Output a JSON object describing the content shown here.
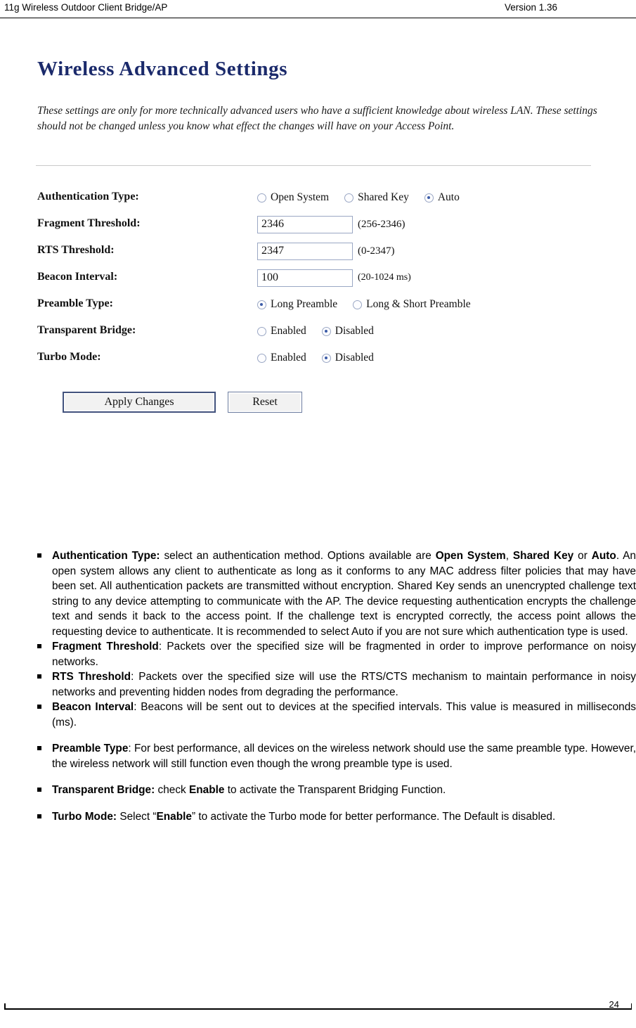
{
  "header": {
    "left_title": "11g Wireless Outdoor Client Bridge/AP",
    "right_version": "Version 1.36"
  },
  "screenshot": {
    "title": "Wireless Advanced Settings",
    "description": "These settings are only for more technically advanced users who have a sufficient knowledge about wireless LAN. These settings should not be changed unless you know what effect the changes will have on your Access Point.",
    "fields": {
      "auth_type": {
        "label": "Authentication Type:",
        "options": [
          "Open System",
          "Shared Key",
          "Auto"
        ],
        "selected": "Auto"
      },
      "fragment_threshold": {
        "label": "Fragment Threshold:",
        "value": "2346",
        "hint": "(256-2346)"
      },
      "rts_threshold": {
        "label": "RTS Threshold:",
        "value": "2347",
        "hint": "(0-2347)"
      },
      "beacon_interval": {
        "label": "Beacon Interval:",
        "value": "100",
        "hint": "(20-1024 ms)"
      },
      "preamble_type": {
        "label": "Preamble Type:",
        "options": [
          "Long Preamble",
          "Long & Short Preamble"
        ],
        "selected": "Long Preamble"
      },
      "transparent_bridge": {
        "label": "Transparent Bridge:",
        "options": [
          "Enabled",
          "Disabled"
        ],
        "selected": "Disabled"
      },
      "turbo_mode": {
        "label": "Turbo Mode:",
        "options": [
          "Enabled",
          "Disabled"
        ],
        "selected": "Disabled"
      }
    },
    "buttons": {
      "apply": "Apply Changes",
      "reset": "Reset"
    }
  },
  "bullets": [
    {
      "term": "Authentication Type:",
      "html": "<b>Authentication Type:</b> select an authentication method. Options available are <b>Open System</b>, <b>Shared Key</b> or <b>Auto</b>. An open system allows any client to authenticate as long as it conforms to any MAC address filter policies that may have been set. All authentication packets are transmitted without encryption. Shared Key sends an unencrypted challenge text string to any device attempting to communicate with the AP. The device requesting authentication encrypts the challenge text and sends it back to the access point. If the challenge text is encrypted correctly, the access point allows the requesting device to authenticate. It is recommended to select Auto if you are not sure which authentication type is used.",
      "gap_after": false
    },
    {
      "term": "Fragment Threshold",
      "html": "<b>Fragment Threshold</b>: Packets over the specified size will be fragmented in order to improve performance on noisy networks.",
      "gap_after": false
    },
    {
      "term": "RTS Threshold",
      "html": "<b>RTS Threshold</b>: Packets over the specified size will use the RTS/CTS mechanism to maintain performance in noisy networks and preventing hidden nodes from degrading the performance.",
      "gap_after": false
    },
    {
      "term": "Beacon Interval",
      "html": "<b>Beacon Interval</b>: Beacons will be sent out to devices at the specified intervals. This value is measured in milliseconds (ms).",
      "gap_after": true
    },
    {
      "term": "Preamble Type:",
      "html": "<b>Preamble Type</b>: For best performance, all devices on the wireless network should use the same preamble type. However, the wireless network will still function even though the wrong preamble type is used.",
      "gap_after": true
    },
    {
      "term": "Transparent Bridge:",
      "html": "<b>Transparent Bridge:</b> check <b>Enable</b> to activate the Transparent Bridging Function.",
      "gap_after": true
    },
    {
      "term": "Turbo Mode:",
      "html": "<b>Turbo Mode:</b> Select &ldquo;<b>Enable</b>&rdquo; to activate the Turbo mode for better performance. The Default is disabled.",
      "gap_after": false
    }
  ],
  "footer": {
    "page_number": "24"
  }
}
